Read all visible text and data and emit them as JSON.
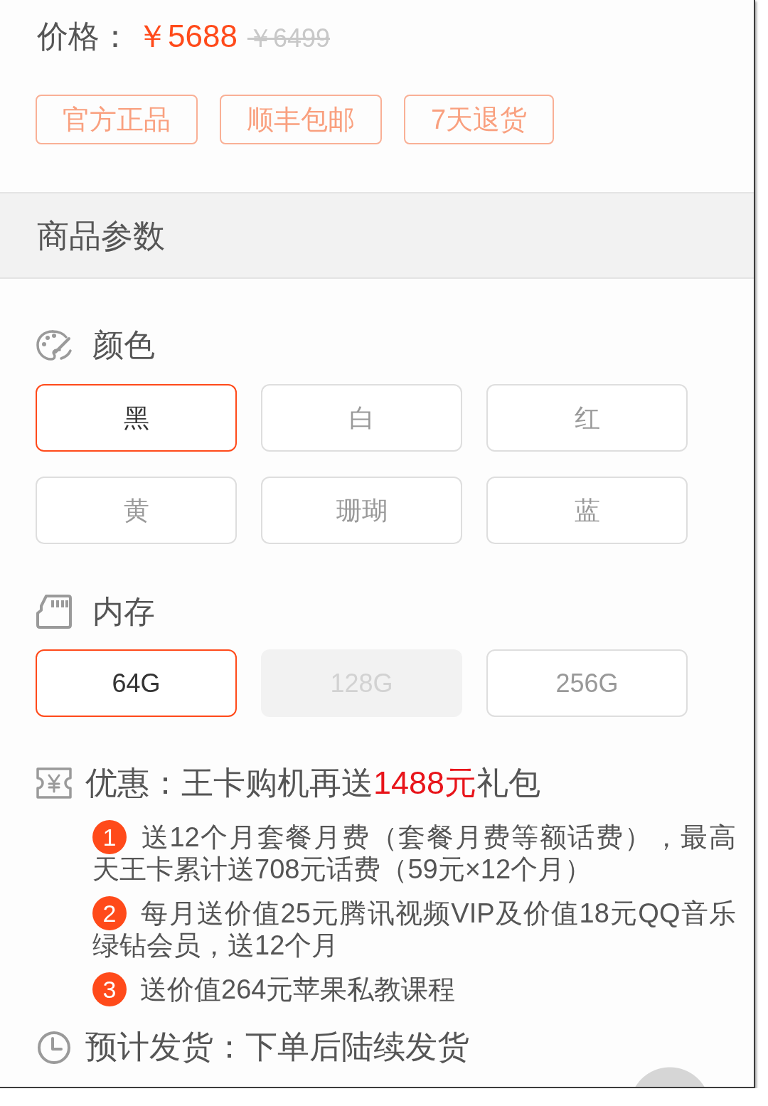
{
  "price": {
    "label": "价格：",
    "current": "￥5688",
    "original": "￥6499"
  },
  "tags": [
    {
      "label": "官方正品"
    },
    {
      "label": "顺丰包邮"
    },
    {
      "label": "7天退货"
    }
  ],
  "section_header": {
    "title": "商品参数"
  },
  "option_groups": [
    {
      "kind": "color",
      "title": "颜色",
      "options": [
        {
          "label": "黑",
          "selected": true,
          "disabled": false
        },
        {
          "label": "白",
          "selected": false,
          "disabled": false
        },
        {
          "label": "红",
          "selected": false,
          "disabled": false
        },
        {
          "label": "黄",
          "selected": false,
          "disabled": false
        },
        {
          "label": "珊瑚",
          "selected": false,
          "disabled": false
        },
        {
          "label": "蓝",
          "selected": false,
          "disabled": false
        }
      ]
    },
    {
      "kind": "memory",
      "title": "内存",
      "options": [
        {
          "label": "64G",
          "selected": true,
          "disabled": false
        },
        {
          "label": "128G",
          "selected": false,
          "disabled": true
        },
        {
          "label": "256G",
          "selected": false,
          "disabled": false
        }
      ]
    }
  ],
  "offer": {
    "text_before": "优惠：王卡购机再送",
    "highlight": "1488元",
    "text_after": "礼包",
    "items": [
      {
        "number": "1",
        "text": "送12个月套餐月费（套餐月费等额话费），最高天王卡累计送708元话费（59元×12个月）"
      },
      {
        "number": "2",
        "text": "每月送价值25元腾讯视频VIP及价值18元QQ音乐绿钻会员，送12个月"
      },
      {
        "number": "3",
        "text": "送价值264元苹果私教课程"
      }
    ]
  },
  "shipping": {
    "text": "预计发货：下单后陆续发货"
  }
}
